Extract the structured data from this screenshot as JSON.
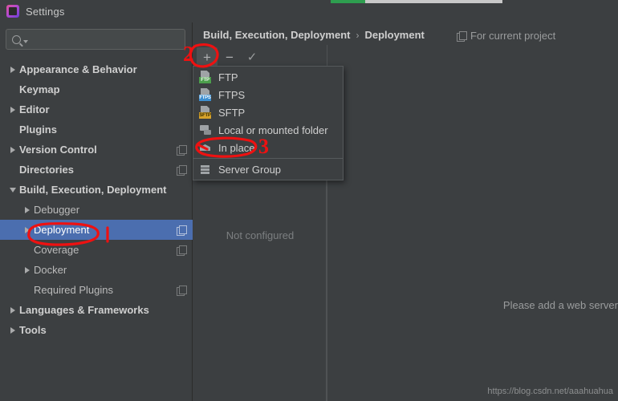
{
  "window": {
    "title": "Settings",
    "logo_icon": "pycharm-logo-icon"
  },
  "progress": {
    "value_percent": 20,
    "fill_color": "#2E9E4F",
    "track_color": "#C8C8C8"
  },
  "search": {
    "value": "",
    "placeholder": "",
    "icon": "search-icon",
    "dropdown_icon": "chevron-down-icon"
  },
  "sidebar": {
    "items": [
      {
        "label": "Appearance & Behavior",
        "arrow": "right",
        "indent": 0,
        "bold": true,
        "badge": false,
        "selected": false
      },
      {
        "label": "Keymap",
        "arrow": "none",
        "indent": 0,
        "bold": true,
        "badge": false,
        "selected": false
      },
      {
        "label": "Editor",
        "arrow": "right",
        "indent": 0,
        "bold": true,
        "badge": false,
        "selected": false
      },
      {
        "label": "Plugins",
        "arrow": "none",
        "indent": 0,
        "bold": true,
        "badge": false,
        "selected": false
      },
      {
        "label": "Version Control",
        "arrow": "right",
        "indent": 0,
        "bold": true,
        "badge": true,
        "selected": false
      },
      {
        "label": "Directories",
        "arrow": "none",
        "indent": 0,
        "bold": true,
        "badge": true,
        "selected": false
      },
      {
        "label": "Build, Execution, Deployment",
        "arrow": "down",
        "indent": 0,
        "bold": true,
        "badge": false,
        "selected": false
      },
      {
        "label": "Debugger",
        "arrow": "right",
        "indent": 1,
        "bold": false,
        "badge": false,
        "selected": false
      },
      {
        "label": "Deployment",
        "arrow": "right",
        "indent": 1,
        "bold": false,
        "badge": true,
        "selected": true
      },
      {
        "label": "Coverage",
        "arrow": "none",
        "indent": 1,
        "bold": false,
        "badge": true,
        "selected": false
      },
      {
        "label": "Docker",
        "arrow": "right",
        "indent": 1,
        "bold": false,
        "badge": false,
        "selected": false
      },
      {
        "label": "Required Plugins",
        "arrow": "none",
        "indent": 1,
        "bold": false,
        "badge": true,
        "selected": false
      },
      {
        "label": "Languages & Frameworks",
        "arrow": "right",
        "indent": 0,
        "bold": true,
        "badge": false,
        "selected": false
      },
      {
        "label": "Tools",
        "arrow": "right",
        "indent": 0,
        "bold": true,
        "badge": false,
        "selected": false
      }
    ]
  },
  "breadcrumb": {
    "parent": "Build, Execution, Deployment",
    "separator": "›",
    "current": "Deployment"
  },
  "scope": {
    "label": "For current project",
    "icon": "copy-scope-icon"
  },
  "toolbar": {
    "add_label": "+",
    "remove_label": "−",
    "default_label": "✓",
    "add_name": "add-server-button",
    "remove_name": "remove-server-button",
    "default_name": "use-as-default-button"
  },
  "server_list": {
    "empty_text": "Not configured"
  },
  "detail_panel": {
    "message": "Please add a web server"
  },
  "popup_menu": {
    "items": [
      {
        "label": "FTP",
        "icon": "ftp-icon",
        "badge": "FTP",
        "kind": "doc"
      },
      {
        "label": "FTPS",
        "icon": "ftps-icon",
        "badge": "FTPS",
        "kind": "doc"
      },
      {
        "label": "SFTP",
        "icon": "sftp-icon",
        "badge": "SFTP",
        "kind": "doc"
      },
      {
        "label": "Local or mounted folder",
        "icon": "local-folder-icon",
        "badge": "",
        "kind": "local"
      },
      {
        "label": "In place",
        "icon": "in-place-icon",
        "badge": "",
        "kind": "house"
      },
      {
        "label": "Server Group",
        "icon": "server-group-icon",
        "badge": "",
        "kind": "servers"
      }
    ],
    "separator_after_index": 4
  },
  "annotations": {
    "color": "#EE1111",
    "marks": [
      {
        "text": "2",
        "target": "add-server-button"
      },
      {
        "text": "3",
        "target": "in-place-menu-item"
      }
    ],
    "circles": [
      {
        "target": "sidebar-item-deployment"
      },
      {
        "target": "add-server-button"
      },
      {
        "target": "in-place-menu-item"
      }
    ]
  },
  "watermark": {
    "text": "https://blog.csdn.net/aaahuahua"
  }
}
